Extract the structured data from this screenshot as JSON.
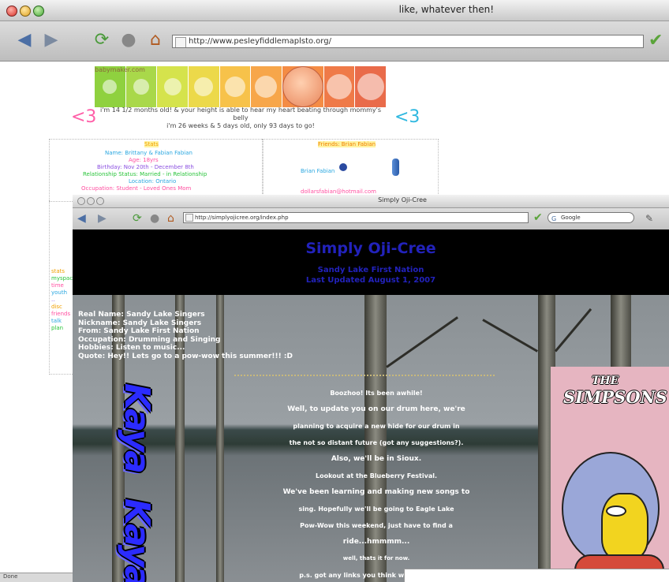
{
  "back_window": {
    "title": "like, whatever then!",
    "url": "http://www.pesleyfiddlemaplsto.org/",
    "fetal_banner": {
      "title": "babymaker.com",
      "caption_line1": "i'm 14 1/2 months old! & your height is able to hear my heart beating through mommy's belly",
      "caption_line2": "i'm 26 weeks & 5 days old, only 93 days to go!",
      "heart_left": "<3",
      "heart_right": "<3",
      "colors": [
        "#8fd13f",
        "#a9d84a",
        "#d5e34c",
        "#ecd94a",
        "#f7c24a",
        "#f7a64a",
        "#f48c45",
        "#ef7a48",
        "#e96b4a"
      ]
    },
    "profile_box": {
      "heading": "Stats",
      "lines": [
        "Name: Brittany & Fabian Fabian",
        "Age: 18yrs",
        "Birthday: Nov 20th - December 8th",
        "Relationship Status: Married - in Relationship",
        "Location: Ontario",
        "Occupation: Student - Loved Ones Mom"
      ]
    },
    "friends_box": {
      "heading": "Friends: Brian Fabian",
      "line1": "Brian Fabian",
      "line2": "dollarsfabian@hotmail.com"
    },
    "left_snippets": [
      "stats",
      "myspace",
      "time",
      "youth",
      "..",
      "disc",
      "friends",
      "talk",
      "plan"
    ]
  },
  "front_window": {
    "title": "Simply Oji-Cree",
    "url": "http://simplyojicree.org/index.php",
    "search_placeholder": "Google",
    "header": {
      "title": "Simply Oji-Cree",
      "subtitle1": "Sandy Lake First Nation",
      "subtitle2": "Last Updated August 1, 2007"
    },
    "info": [
      "Real Name: Sandy Lake Singers",
      "Nickname: Sandy Lake Singers",
      "From: Sandy Lake First Nation",
      "Occupation: Drumming and Singing",
      "Hobbies: Listen to music...",
      "Quote: Hey!! Lets go to a pow-wow this summer!!! :D"
    ],
    "body": [
      "Boozhoo!  Its been awhile!",
      "Well, to update you on our drum here, we're",
      "planning to acquire a new hide for our drum in",
      "the not so distant future (got any suggestions?).",
      "Also, we'll be in Sioux.",
      "Lookout at the Blueberry Festival.",
      "We've been learning and making new songs to",
      "sing.  Hopefully we'll be going to Eagle Lake",
      "Pow-Wow this weekend, just have to find a",
      "ride...hmmmm...",
      "well, thats it for now.",
      "p.s. got any links you think we should add?"
    ],
    "graffiti_top": "Kaya",
    "graffiti_bottom": "Kaya",
    "simpsons_the": "THE",
    "simpsons_name": "SIMPSONS"
  },
  "status_text": "Done"
}
